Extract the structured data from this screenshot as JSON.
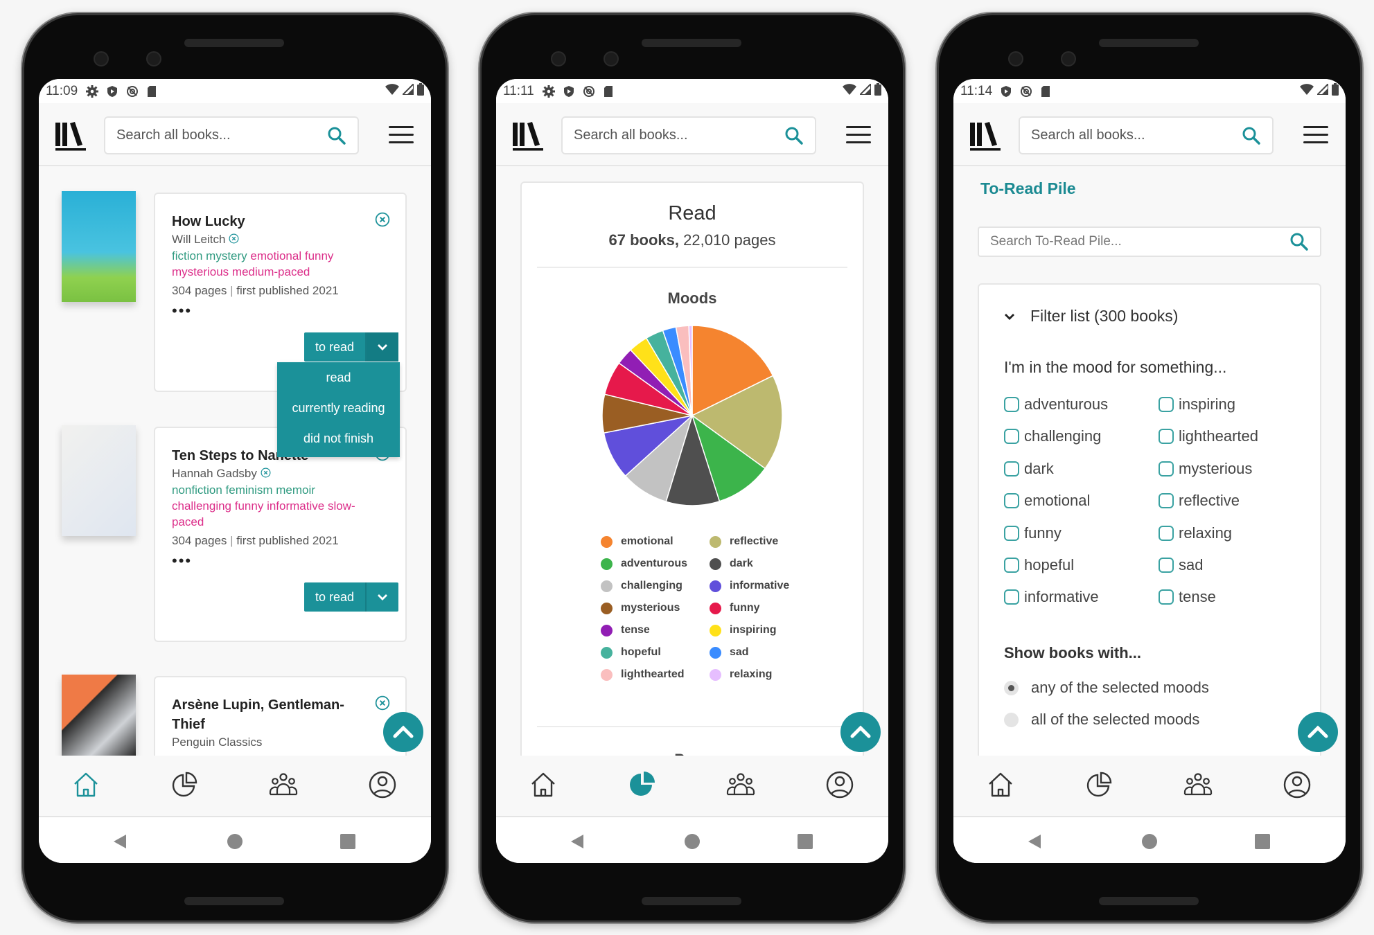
{
  "accent_color": "#1b9199",
  "common": {
    "search_placeholder": "Search all books...",
    "nav_items": [
      "home-icon",
      "stats-pie-icon",
      "community-icon",
      "profile-icon"
    ]
  },
  "phones": [
    {
      "time": "11:09",
      "active_nav": 0,
      "books": [
        {
          "title": "How Lucky",
          "author": "Will Leitch",
          "genres": [
            "fiction",
            "mystery"
          ],
          "moods_pace": [
            "emotional",
            "funny",
            "mysterious",
            "medium-paced"
          ],
          "pages": "304 pages",
          "published": "first published 2021",
          "status": "to read"
        },
        {
          "title": "Ten Steps to Nanette",
          "author": "Hannah Gadsby",
          "genres": [
            "nonfiction",
            "feminism",
            "memoir"
          ],
          "moods_pace": [
            "challenging",
            "funny",
            "informative",
            "slow-paced"
          ],
          "pages": "304 pages",
          "published": "first published 2021",
          "status": "to read"
        },
        {
          "title": "Arsène Lupin, Gentleman-Thief",
          "author": "Penguin Classics"
        }
      ],
      "status_menu": [
        "read",
        "currently reading",
        "did not finish"
      ],
      "separator": "|",
      "more": "•••"
    },
    {
      "time": "11:11",
      "active_nav": 1,
      "stats_title": "Read",
      "stats_books": "67 books,",
      "stats_pages": "22,010 pages",
      "next_section": "Pace"
    },
    {
      "time": "11:14",
      "active_nav": -1,
      "page_title": "To-Read Pile",
      "search_placeholder": "Search To-Read Pile...",
      "filter_label": "Filter list (300 books)",
      "mood_prompt": "I'm in the mood for something...",
      "moods_col1": [
        "adventurous",
        "challenging",
        "dark",
        "emotional",
        "funny",
        "hopeful",
        "informative"
      ],
      "moods_col2": [
        "inspiring",
        "lighthearted",
        "mysterious",
        "reflective",
        "relaxing",
        "sad",
        "tense"
      ],
      "show_with": "Show books with...",
      "match_options": [
        "any of the selected moods",
        "all of the selected moods"
      ],
      "match_selected": 0
    }
  ],
  "chart_data": {
    "type": "pie",
    "title": "Moods",
    "unit": "percent (estimated)",
    "slices": [
      {
        "label": "emotional",
        "value": 17.7,
        "color": "#f5842f"
      },
      {
        "label": "reflective",
        "value": 17.3,
        "color": "#bdb96f"
      },
      {
        "label": "adventurous",
        "value": 10.1,
        "color": "#3cb44b"
      },
      {
        "label": "dark",
        "value": 9.6,
        "color": "#4f4f4f"
      },
      {
        "label": "challenging",
        "value": 8.6,
        "color": "#c2c2c2"
      },
      {
        "label": "informative",
        "value": 8.6,
        "color": "#604fdb"
      },
      {
        "label": "mysterious",
        "value": 6.9,
        "color": "#9a5e23"
      },
      {
        "label": "funny",
        "value": 6.1,
        "color": "#e6194b"
      },
      {
        "label": "tense",
        "value": 3.1,
        "color": "#911eb4"
      },
      {
        "label": "inspiring",
        "value": 3.5,
        "color": "#ffe119"
      },
      {
        "label": "hopeful",
        "value": 3.2,
        "color": "#46b29d"
      },
      {
        "label": "sad",
        "value": 2.4,
        "color": "#3a8cff"
      },
      {
        "label": "lighthearted",
        "value": 2.3,
        "color": "#fabebe"
      },
      {
        "label": "relaxing",
        "value": 0.6,
        "color": "#e6beff"
      }
    ],
    "legend_order": [
      "emotional",
      "reflective",
      "adventurous",
      "dark",
      "challenging",
      "informative",
      "mysterious",
      "funny",
      "tense",
      "inspiring",
      "hopeful",
      "sad",
      "lighthearted",
      "relaxing"
    ],
    "legend_placement": "bottom"
  }
}
